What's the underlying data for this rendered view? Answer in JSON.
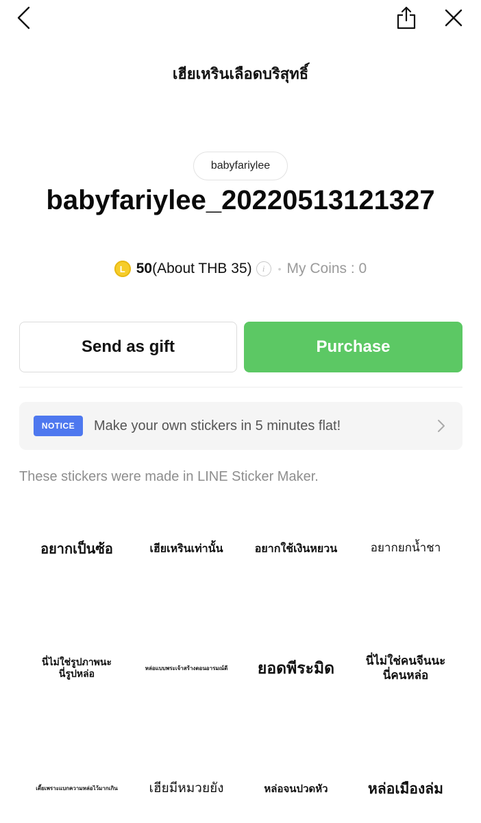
{
  "header": {
    "back_icon": "chevron-left-icon",
    "share_icon": "share-icon",
    "close_icon": "close-icon",
    "title": "เฮียเหรินเลือดบริสุทธิ์"
  },
  "pack": {
    "author": "babyfariylee",
    "title": "babyfariylee_20220513121327",
    "coin_symbol": "L",
    "price": "50",
    "price_about": "(About THB 35)",
    "info_icon": "i",
    "dot": "•",
    "my_coins": "My Coins : 0"
  },
  "actions": {
    "gift_label": "Send as gift",
    "purchase_label": "Purchase"
  },
  "notice": {
    "badge": "NOTICE",
    "text": "Make your own stickers in 5 minutes flat!"
  },
  "maker_note": "These stickers were made in LINE Sticker Maker.",
  "stickers": [
    "อยากเป็นซ้อ",
    "เฮียเหรินเท่านั้น",
    "อยากใช้เงินหยวน",
    "อยากยกน้ำชา",
    "นี่ไม่ใช่รูปภาพนะ\nนี่รูปหล่อ",
    "หล่อแบบพระเจ้าสร้างตอนอารมณ์ดี",
    "ยอดพีระมิด",
    "นี่ไม่ใช่คนจีนนะ\nนี่คนหล่อ",
    "เตี้ยเพราะแบกความหล่อไว้มากเกิน",
    "เฮียมีหมวยยัง",
    "หล่อจนปวดหัว",
    "หล่อเมืองล่ม"
  ],
  "colors": {
    "purchase_green": "#5cc864",
    "notice_blue": "#4e78ef",
    "coin_yellow": "#f6cd2a"
  }
}
